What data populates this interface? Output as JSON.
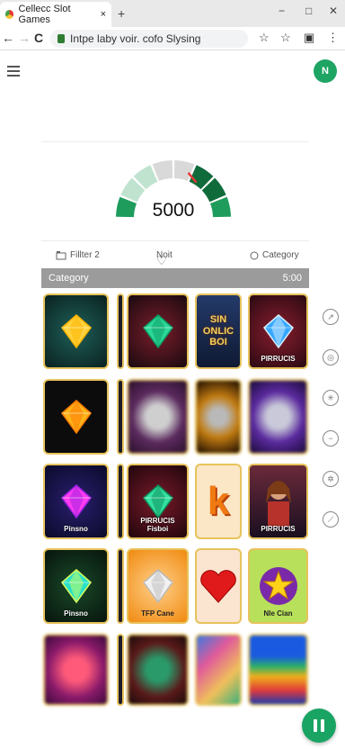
{
  "browser": {
    "tab_title": "Cellecc Slot Games",
    "tab_close": "×",
    "new_tab": "+",
    "address": "Intpe laby voir. cofo Slysing",
    "win_min": "−",
    "win_max": "□",
    "win_close": "✕",
    "back": "←",
    "forward": "→",
    "reload": "C"
  },
  "header": {
    "avatar_initial": "N"
  },
  "gauge": {
    "value": "5000",
    "level": 0.72,
    "colors": {
      "dark": "#0f6b3a",
      "mid": "#1e9c5c",
      "light": "#bfe3cf",
      "needle": "#e53935"
    }
  },
  "filters": {
    "filter": "Fillter 2",
    "note": "Noit",
    "category": "Category"
  },
  "category_bar": {
    "label": "Category",
    "value": "5:00"
  },
  "tiles": [
    {
      "id": "t1",
      "style": "gem-yellow",
      "caption": ""
    },
    {
      "id": "t2",
      "style": "strip",
      "caption": ""
    },
    {
      "id": "t3",
      "style": "gem-green-dark",
      "caption": ""
    },
    {
      "id": "t4",
      "style": "text-banner",
      "caption": "",
      "big": "SIN\nONLIC\nBOI"
    },
    {
      "id": "t5",
      "style": "gem-blue",
      "caption": "PIRRUCIS"
    },
    {
      "id": "t6",
      "style": "gem-orange",
      "caption": ""
    },
    {
      "id": "t7",
      "style": "strip",
      "caption": ""
    },
    {
      "id": "t8",
      "style": "blur-purple",
      "caption": ""
    },
    {
      "id": "t9",
      "style": "blur-gold",
      "caption": ""
    },
    {
      "id": "t10",
      "style": "blur-violet",
      "caption": ""
    },
    {
      "id": "t11",
      "style": "gem-magenta",
      "caption": "Pinsno"
    },
    {
      "id": "t12",
      "style": "strip",
      "caption": ""
    },
    {
      "id": "t13",
      "style": "gem-green",
      "caption": "PIRRUCIS\nFisboi"
    },
    {
      "id": "t14",
      "style": "letter-k",
      "caption": "",
      "big": "k"
    },
    {
      "id": "t15",
      "style": "portrait",
      "caption": "PIRRUCIS"
    },
    {
      "id": "t16",
      "style": "gem-teal",
      "caption": "Pinsno"
    },
    {
      "id": "t17",
      "style": "strip",
      "caption": ""
    },
    {
      "id": "t18",
      "style": "diamond-orange",
      "caption": "TFP Cane"
    },
    {
      "id": "t19",
      "style": "heart",
      "caption": ""
    },
    {
      "id": "t20",
      "style": "star",
      "caption": "Nle Cian"
    },
    {
      "id": "t21",
      "style": "blur-red",
      "caption": ""
    },
    {
      "id": "t22",
      "style": "strip",
      "caption": ""
    },
    {
      "id": "t23",
      "style": "blur-green",
      "caption": ""
    },
    {
      "id": "t24",
      "style": "blur-rainbow",
      "caption": ""
    },
    {
      "id": "t25",
      "style": "blur-pyramid",
      "caption": ""
    }
  ],
  "side_icons": [
    "chart-icon",
    "globe-icon",
    "network-icon",
    "minus-circle-icon",
    "share-icon",
    "link-icon"
  ],
  "fab": {
    "icon": "pause-icon"
  }
}
